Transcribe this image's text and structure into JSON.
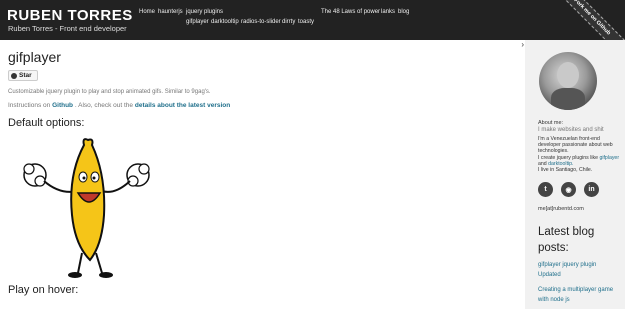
{
  "header": {
    "title": "RUBEN TORRES",
    "subtitle": "Ruben Torres - Front end developer",
    "nav_row1": [
      "Home",
      "haunterjs",
      "jquery plugins"
    ],
    "nav_row1_right": [
      "The 48 Laws of power",
      "lanks",
      "blog"
    ],
    "nav_row2": [
      "gifplayer",
      "darktooltip",
      "radios-to-slider",
      "dirrty",
      "toasty"
    ],
    "ribbon": "Fork me on Github"
  },
  "main": {
    "page_title": "gifplayer",
    "star_label": "Star",
    "description": "Customizable jquery plugin to play and stop animated gifs. Similar to 9gag's.",
    "instructions_prefix": "Instructions on",
    "instructions_link": "Github",
    "instructions_middle": ". Also, check out the",
    "latest_link": "details about the latest version",
    "section_default": "Default options:",
    "section_hover": "Play on hover:"
  },
  "sidebar": {
    "about_label": "About me:",
    "about_tagline": "I make websites and shit",
    "about_line1": "I'm a Venezuelan front-end developer passionate about web technologies.",
    "about_line2_prefix": "I create jquery plugins like",
    "about_link1": "gifplayer",
    "about_and": "and",
    "about_link2": "darktooltip.",
    "about_line3": "I live in Santiago, Chile.",
    "email": "me[at]rubentd.com",
    "blog_title": "Latest blog posts:",
    "blog_posts": [
      "gifplayer jquery plugin Updated",
      "Creating a multiplayer game with node js"
    ]
  },
  "colors": {
    "header_bg": "#222222",
    "link": "#1f6f8b",
    "sidebar_bg": "#f1f1f1",
    "banana": "#f5c518"
  },
  "icons": [
    "github-icon",
    "twitter-icon",
    "github-icon",
    "linkedin-icon",
    "chevron-right-icon"
  ]
}
